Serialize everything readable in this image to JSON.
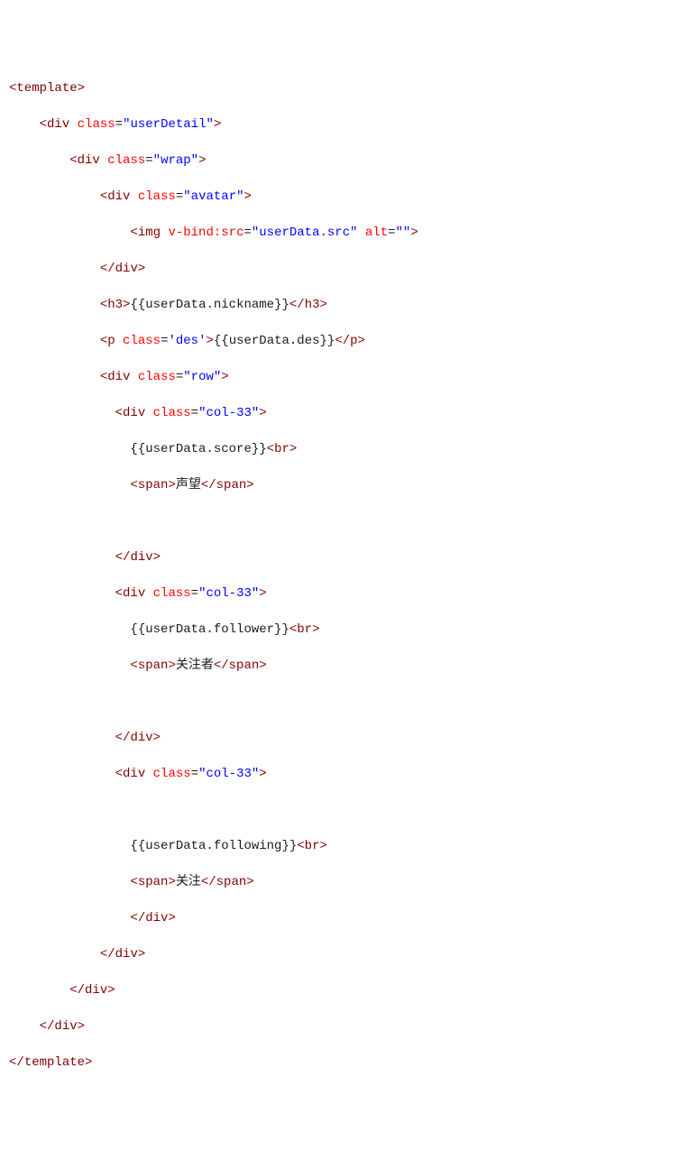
{
  "code": {
    "l1": {
      "open": "<",
      "tag": "template",
      "close": ">"
    },
    "l2": {
      "open": "<",
      "tag": "div",
      "attrName": "class",
      "attrVal": "\"userDetail\"",
      "close": ">"
    },
    "l3": {
      "open": "<",
      "tag": "div",
      "attrName": "class",
      "attrVal": "\"wrap\"",
      "close": ">"
    },
    "l4": {
      "open": "<",
      "tag": "div",
      "attrName": "class",
      "attrVal": "\"avatar\"",
      "close": ">"
    },
    "l5": {
      "open": "<",
      "tag": "img",
      "attr1": "v-bind:src",
      "attr1Val": "\"userData.src\"",
      "attr2": "alt",
      "attr2Val": "\"\"",
      "close": ">"
    },
    "l6": {
      "open": "</",
      "tag": "div",
      "close": ">"
    },
    "l7": {
      "open": "<",
      "tag": "h3",
      "close": ">",
      "text": "{{userData.nickname}}",
      "open2": "</",
      "close2": ">"
    },
    "l8": {
      "open": "<",
      "tag": "p",
      "attrName": "class",
      "attrVal": "'des'",
      "close": ">",
      "text": "{{userData.des}}",
      "open2": "</",
      "close2": ">"
    },
    "l9": {
      "open": "<",
      "tag": "div",
      "attrName": "class",
      "attrVal": "\"row\"",
      "close": ">"
    },
    "l10": {
      "open": "<",
      "tag": "div",
      "attrName": "class",
      "attrVal": "\"col-33\"",
      "close": ">"
    },
    "l11": {
      "text": "{{userData.score}}",
      "brOpen": "<",
      "brTag": "br",
      "brClose": ">"
    },
    "l12": {
      "open": "<",
      "tag": "span",
      "close": ">",
      "text": "声望",
      "open2": "</",
      "close2": ">"
    },
    "l13": {
      "open": "</",
      "tag": "div",
      "close": ">"
    },
    "l14": {
      "open": "<",
      "tag": "div",
      "attrName": "class",
      "attrVal": "\"col-33\"",
      "close": ">"
    },
    "l15": {
      "text": "{{userData.follower}}",
      "brOpen": "<",
      "brTag": "br",
      "brClose": ">"
    },
    "l16": {
      "open": "<",
      "tag": "span",
      "close": ">",
      "text": "关注者",
      "open2": "</",
      "close2": ">"
    },
    "l17": {
      "open": "</",
      "tag": "div",
      "close": ">"
    },
    "l18": {
      "open": "<",
      "tag": "div",
      "attrName": "class",
      "attrVal": "\"col-33\"",
      "close": ">"
    },
    "l19": {
      "text": "{{userData.following}}",
      "brOpen": "<",
      "brTag": "br",
      "brClose": ">"
    },
    "l20": {
      "open": "<",
      "tag": "span",
      "close": ">",
      "text": "关注",
      "open2": "</",
      "close2": ">"
    },
    "l21": {
      "open": "</",
      "tag": "div",
      "close": ">"
    },
    "l22": {
      "open": "</",
      "tag": "div",
      "close": ">"
    },
    "l23": {
      "open": "</",
      "tag": "div",
      "close": ">"
    },
    "l24": {
      "open": "</",
      "tag": "div",
      "close": ">"
    },
    "l25": {
      "open": "</",
      "tag": "template",
      "close": ">"
    }
  }
}
